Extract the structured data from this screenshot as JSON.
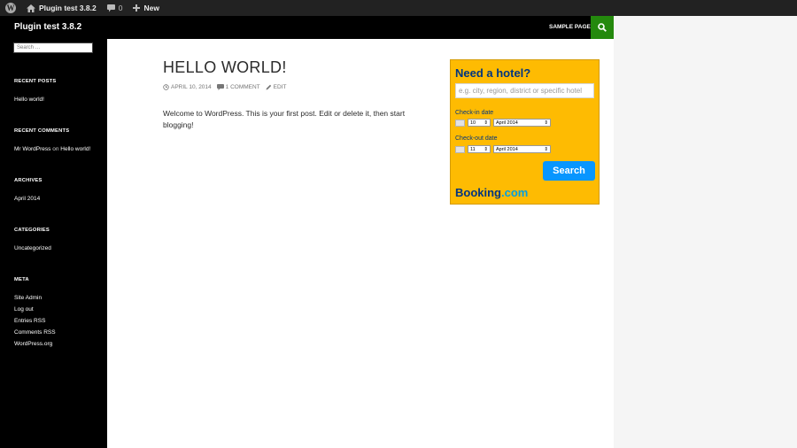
{
  "adminbar": {
    "site_name": "Plugin test 3.8.2",
    "comments_count": "0",
    "new_label": "New"
  },
  "header": {
    "site_title": "Plugin test 3.8.2",
    "nav_sample_page": "SAMPLE PAGE",
    "accent_color": "#24890d"
  },
  "sidebar": {
    "search_placeholder": "Search …",
    "recent_posts_title": "RECENT POSTS",
    "recent_posts": [
      "Hello world!"
    ],
    "recent_comments_title": "RECENT COMMENTS",
    "recent_comment_author": "Mr WordPress",
    "recent_comment_on": "on",
    "recent_comment_post": "Hello world!",
    "archives_title": "ARCHIVES",
    "archives": [
      "April 2014"
    ],
    "categories_title": "CATEGORIES",
    "categories": [
      "Uncategorized"
    ],
    "meta_title": "META",
    "meta_links": [
      "Site Admin",
      "Log out",
      "Entries RSS",
      "Comments RSS",
      "WordPress.org"
    ]
  },
  "post": {
    "title": "HELLO WORLD!",
    "date": "APRIL 10, 2014",
    "comments": "1 COMMENT",
    "edit": "EDIT",
    "body": "Welcome to WordPress. This is your first post. Edit or delete it, then start blogging!"
  },
  "booking": {
    "title": "Need a hotel?",
    "destination_placeholder": "e.g. city, region, district or specific hotel",
    "checkin_label": "Check-in date",
    "checkin_day": "10",
    "checkin_month": "April 2014",
    "checkout_label": "Check-out date",
    "checkout_day": "11",
    "checkout_month": "April 2014",
    "search_label": "Search",
    "logo_part1": "Booking",
    "logo_part2": ".com",
    "bg_color": "#febb02",
    "button_color": "#0896ff"
  }
}
